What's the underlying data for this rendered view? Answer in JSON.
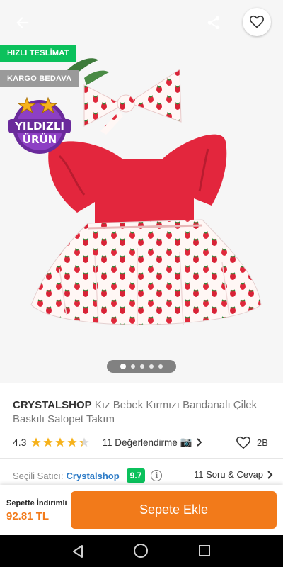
{
  "header": {
    "back_icon": "arrow-left-icon",
    "share_icon": "share-icon",
    "favorite_icon": "heart-outline-icon"
  },
  "badges": {
    "fast_delivery": "HIZLI TESLİMAT",
    "free_shipping": "KARGO BEDAVA",
    "star_product_line1": "YILDIZLI",
    "star_product_line2": "ÜRÜN"
  },
  "gallery": {
    "image_count": 5,
    "active_index": 0
  },
  "product": {
    "brand": "CRYSTALSHOP",
    "name": "Kız Bebek Kırmızı Bandanalı Çilek Baskılı Salopet Takım"
  },
  "rating": {
    "score": "4.3",
    "stars_value": 4.3,
    "reviews": "11 Değerlendirme",
    "camera_icon": "📷",
    "likes": "2B"
  },
  "seller": {
    "label": "Seçili Satıcı:",
    "name": "Crystalshop",
    "score": "9.7",
    "qa": "11 Soru & Cevap"
  },
  "cart": {
    "price_label": "Sepette İndirimli",
    "price": "92.81 TL",
    "button": "Sepete Ekle"
  },
  "colors": {
    "accent": "#f27a1a",
    "green": "#0bc15c",
    "link": "#2e7cc7",
    "dress_red": "#e3263d"
  }
}
